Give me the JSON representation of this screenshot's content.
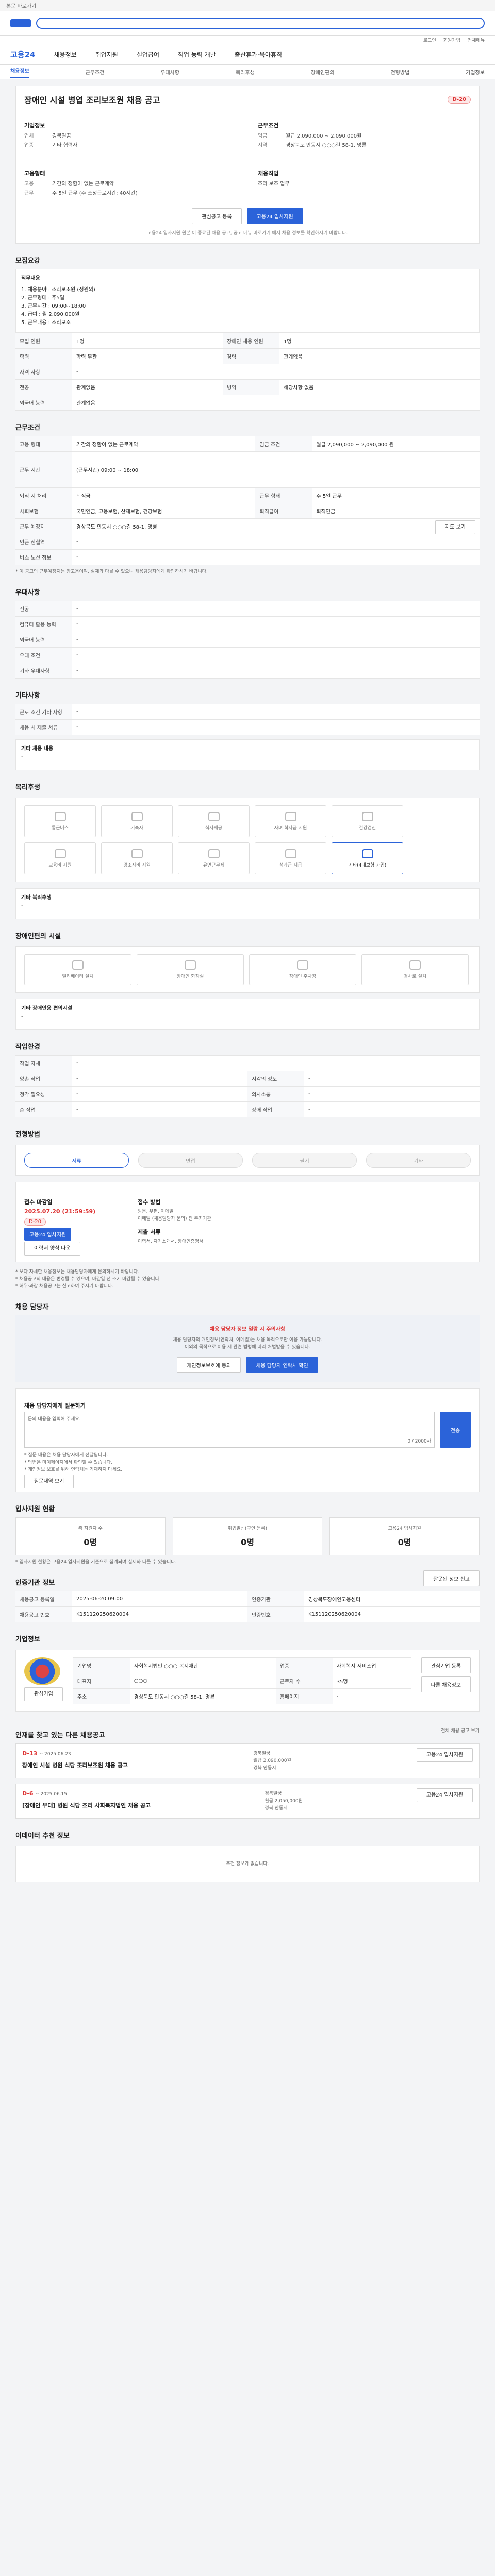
{
  "topbar": {
    "notice": "본문 바로가기"
  },
  "nav": {
    "brand": "고용24",
    "items": [
      "채용정보",
      "취업지원",
      "실업급여",
      "직업 능력 개발",
      "출산휴가·육아휴직"
    ]
  },
  "util": [
    "로그인",
    "회원가입",
    "전체메뉴"
  ],
  "tabs": [
    "채용정보",
    "근무조건",
    "우대사항",
    "복리후생",
    "장애인편의",
    "전형방법",
    "기업정보"
  ],
  "job": {
    "title": "장애인 시설 병엽 조리보조원 채용 공고",
    "dday": "D-20",
    "company_label": "기업정보",
    "company_rows": [
      {
        "k": "업체",
        "v": "경북일꿈"
      },
      {
        "k": "업종",
        "v": "기타 협력사"
      }
    ],
    "condition_label": "근무조건",
    "condition_rows": [
      {
        "k": "임금",
        "v": "월급 2,090,000 ~ 2,090,000원"
      },
      {
        "k": "지역",
        "v": "경상북도 안동시 ○○○길 58-1, 명륜"
      }
    ],
    "employ_label": "고용형태",
    "employ_rows": [
      {
        "k": "고용",
        "v": "기간의 정함이 없는 근로계약"
      },
      {
        "k": "근무",
        "v": "주 5일 근무 (주 소정근로시간: 40시간)"
      }
    ],
    "career_label": "채용직업",
    "career_value": "조리 보조 업무",
    "buttons": {
      "save": "관심공고 등록",
      "apply": "고용24 입사지원"
    },
    "note": "고용24 입사지원 원본 이 종료된 채용 공고, 공고 메뉴 바로가기 에서 채용 정보를 확인하시기 바랍니다."
  },
  "recruit": {
    "title": "모집요강",
    "duty_title": "직무내용",
    "duties": [
      "1. 채용분야 : 조리보조원 (정원외)",
      "2. 근무형태 : 주5일",
      "3. 근무시간 : 09:00~18:00",
      "4. 급여 : 월 2,090,000원",
      "5. 근무내용 : 조리보조"
    ],
    "rows": [
      {
        "k": "모집 인원",
        "v": "1명",
        "k2": "장애인 채용 인원",
        "v2": "1명"
      },
      {
        "k": "학력",
        "v": "학력 무관",
        "k2": "경력",
        "v2": "관계없음"
      },
      {
        "k": "자격 사항",
        "v": "-",
        "k2": "",
        "v2": ""
      },
      {
        "k": "전공",
        "v": "관계없음",
        "k2": "병역",
        "v2": "해당사항 없음"
      },
      {
        "k": "외국어 능력",
        "v": "관계없음",
        "k2": "",
        "v2": ""
      }
    ]
  },
  "conditions": {
    "title": "근무조건",
    "rows": [
      {
        "k": "고용 형태",
        "v": "기간의 정함이 없는 근로계약",
        "k2": "임금 조건",
        "v2": "월급 2,090,000 ~ 2,090,000 원"
      },
      {
        "k": "근무 시간",
        "v": "(근무시간) 09:00 ~ 18:00",
        "k2": "",
        "v2": ""
      },
      {
        "k": "퇴직 시 처리",
        "v": "퇴직금",
        "k2": "근무 형태",
        "v2": "주 5일 근무"
      },
      {
        "k": "사회보험",
        "v": "국민연금, 고용보험, 산재보험, 건강보험",
        "k2": "퇴직급여",
        "v2": "퇴직연금"
      },
      {
        "k": "근무 예정지",
        "v": "경상북도 안동시 ○○○길 58-1, 명륜",
        "k2": "",
        "v2": ""
      },
      {
        "k": "인근 전철역",
        "v": "-",
        "k2": "",
        "v2": ""
      },
      {
        "k": "버스 노선 정보",
        "v": "-",
        "k2": "",
        "v2": ""
      }
    ],
    "map_button": "지도 보기",
    "note": "* 이 공고의 근무예정지는 참고용이며, 실제와 다를 수 있으니 채용담당자에게 확인하시기 바랍니다."
  },
  "prefer": {
    "title": "우대사항",
    "rows": [
      {
        "k": "전공",
        "v": "-"
      },
      {
        "k": "컴퓨터 활용 능력",
        "v": "-"
      },
      {
        "k": "외국어 능력",
        "v": "-"
      },
      {
        "k": "우대 조건",
        "v": "-"
      },
      {
        "k": "기타 우대사항",
        "v": "-"
      }
    ]
  },
  "other": {
    "title": "기타사항",
    "rows": [
      {
        "k": "근로 조건 기타 사항",
        "v": "-"
      },
      {
        "k": "채용 시 제출 서류",
        "v": "-"
      }
    ],
    "extra_label": "기타 채용 내용",
    "extra_value": "-"
  },
  "welfare": {
    "title": "복리후생",
    "tiles": [
      "통근버스",
      "기숙사",
      "식사제공",
      "자녀 학자금 지원",
      "건강검진",
      "교육비 지원",
      "경조사비 지원",
      "유연근무제",
      "성과급 지급",
      "기타(4대보험 가입)"
    ],
    "active_index": 9,
    "extra_label": "기타 복리후생",
    "extra_value": "-"
  },
  "disability": {
    "title": "장애인편의 시설",
    "tiles": [
      "엘리베이터 설치",
      "장애인 화장실",
      "장애인 주차장",
      "경사로 설치"
    ],
    "extra_label": "기타 장애인용 편의시설",
    "extra_value": "-"
  },
  "work_env": {
    "title": "작업환경",
    "rows": [
      {
        "k": "작업 자세",
        "v": "-",
        "k2": "",
        "v2": ""
      },
      {
        "k": "양손 작업",
        "v": "-",
        "k2": "시각의 정도",
        "v2": "-"
      },
      {
        "k": "청각 필요성",
        "v": "-",
        "k2": "의사소통",
        "v2": "-"
      },
      {
        "k": "손 작업",
        "v": "-",
        "k2": "장애 작업",
        "v2": "-"
      }
    ]
  },
  "process": {
    "title": "전형방법",
    "steps": [
      "서류",
      "면접",
      "필기",
      "기타"
    ],
    "deadline_label": "접수 마감일",
    "deadline": "2025.07.20 (21:59:59)",
    "dday": "D-20",
    "apply_button": "고용24 입사지원",
    "print_button": "이력서 양식 다운",
    "method_label": "접수 방법",
    "method": "방문, 우편, 이메일",
    "method_detail": "이메일 (채용담당자 문의) 전 주최기관",
    "docs_label": "제출 서류",
    "docs": "이력서, 자기소개서, 장애인증명서",
    "notes": [
      "* 보다 자세한 채용정보는 채용담당자에게 문의하시기 바랍니다.",
      "* 채용공고의 내용은 변경될 수 있으며, 마감일 전 조기 마감될 수 있습니다.",
      "* 허위·과장 채용공고는 신고하여 주시기 바랍니다."
    ]
  },
  "contact": {
    "title": "채용 담당자",
    "warning": "채용 담당자 정보 열람 시 주의사항",
    "warning_body": "채용 담당자의 개인정보(연락처, 이메일)는 채용 목적으로만 이용 가능합니다.",
    "warning_body2": "이외의 목적으로 이용 시 관련 법령에 따라 처벌받을 수 있습니다.",
    "btn_view": "개인정보보호에 동의",
    "btn_show": "채용 담당자 연락처 확인",
    "ask_title": "채용 담당자에게 질문하기",
    "ask_placeholder": "문의 내용을 입력해 주세요.",
    "ask_count": "0 / 2000자",
    "ask_button": "전송",
    "notes": [
      "* 질문 내용은 채용 담당자에게 전달됩니다.",
      "* 답변은 마이페이지에서 확인할 수 있습니다.",
      "* 개인정보 보호를 위해 연락처는 기재하지 마세요."
    ],
    "ask_list_button": "질문내역 보기"
  },
  "stats": {
    "title": "입사지원 현황",
    "items": [
      {
        "k": "총 지원자 수",
        "v": "0명"
      },
      {
        "k": "취업알선(구인 등록)",
        "v": "0명"
      },
      {
        "k": "고용24 입사지원",
        "v": "0명"
      }
    ],
    "note": "* 입사지원 현황은 고용24 입사지원을 기준으로 집계되며 실제와 다를 수 있습니다."
  },
  "meta": {
    "title": "인증기관 정보",
    "report_button": "잘못된 정보 신고",
    "rows": [
      {
        "k": "채용공고 등록일",
        "v": "2025-06-20 09:00",
        "k2": "인증기관",
        "v2": "경상북도장애인고용센터"
      },
      {
        "k": "채용공고 번호",
        "v": "K151120250620004",
        "k2": "인증번호",
        "v2": "K151120250620004"
      }
    ]
  },
  "company": {
    "title": "기업정보",
    "follow_button": "관심기업",
    "rows": [
      {
        "k": "기업명",
        "v": "사회복지법인 ○○○ 복지재단",
        "k2": "업종",
        "v2": "사회복지 서비스업"
      },
      {
        "k": "대표자",
        "v": "○○○",
        "k2": "근로자 수",
        "v2": "35명"
      },
      {
        "k": "주소",
        "v": "경상북도 안동시 ○○○길 58-1, 명륜",
        "k2": "홈페이지",
        "v2": "-"
      }
    ],
    "buttons": [
      "관심기업 등록",
      "다른 채용정보"
    ]
  },
  "related": {
    "title": "인재를 찾고 있는 다른 채용공고",
    "more": "전체 채용 공고 보기",
    "jobs": [
      {
        "dday": "D-13",
        "date": "~ 2025.06.23",
        "title": "장애인 시설 병원 식당 조리보조원 채용 공고",
        "company": "경북일꿈",
        "wage": "월급 2,090,000원",
        "loc": "경북 안동시",
        "button": "고용24 입사지원"
      },
      {
        "dday": "D-6",
        "date": "~ 2025.06.15",
        "title": "[장애인 우대] 병원 식당 조리 사회복지법인 채용 공고",
        "company": "경북일꿈",
        "wage": "월급 2,050,000원",
        "loc": "경북 안동시",
        "button": "고용24 입사지원"
      }
    ]
  },
  "recommend": {
    "title": "이데이터 추천 정보",
    "empty": "추천 정보가 없습니다."
  }
}
